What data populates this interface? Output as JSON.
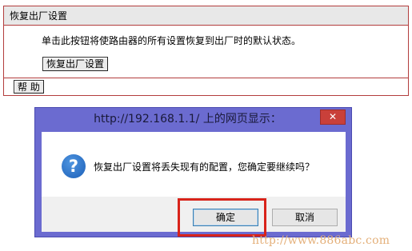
{
  "panel": {
    "title": "恢复出厂设置",
    "description": "单击此按钮将使路由器的所有设置恢复到出厂时的默认状态。",
    "reset_button": "恢复出厂设置",
    "help_button": "帮 助"
  },
  "dialog": {
    "title": "http://192.168.1.1/ 上的网页显示：",
    "close_glyph": "✕",
    "icon": "question-icon",
    "message": "恢复出厂设置将丢失现有的配置，您确定要继续吗？",
    "ok_button": "确定",
    "cancel_button": "取消"
  },
  "watermark": "http://www.886abc.com",
  "colors": {
    "panel_border": "#b33d3d",
    "dialog_frame": "#6b6bd0",
    "close_button": "#c9403a",
    "highlight": "#d8231a",
    "watermark": "#e4b07a"
  }
}
